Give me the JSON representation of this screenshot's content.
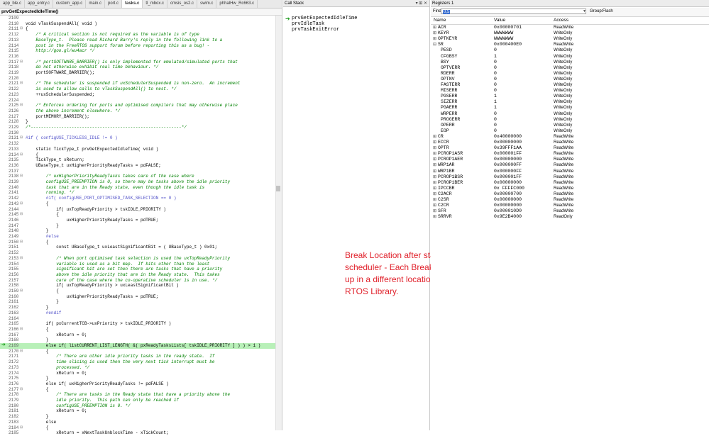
{
  "editor": {
    "tabs": [
      "app_ble.c",
      "app_entry.c",
      "custom_app.c",
      "main.c",
      "port.c",
      "tasks.c",
      "tl_mbox.c",
      "cmsis_os2.c",
      "swim.c",
      "phhalHw_Rc663.c"
    ],
    "active_tab": "tasks.c",
    "function_bar": "prvGetExpectedIdleTime()",
    "lines": [
      {
        "n": "2109",
        "t": ""
      },
      {
        "n": "2110",
        "t": "void vTaskSuspendAll( void )"
      },
      {
        "n": "2111",
        "t": "{",
        "f": "⊟"
      },
      {
        "n": "2112",
        "t": "    /* A critical section is not required as the variable is of type",
        "c": 1
      },
      {
        "n": "2113",
        "t": "    BaseType_t.  Please read Richard Barry's reply in the following link to a",
        "c": 1
      },
      {
        "n": "2114",
        "t": "    post in the FreeRTOS support forum before reporting this as a bug! -",
        "c": 1
      },
      {
        "n": "2115",
        "t": "    http://goo.gl/wu4acr */",
        "c": 1
      },
      {
        "n": "2116",
        "t": ""
      },
      {
        "n": "2117",
        "t": "    /* portSOFTWARE_BARRIER() is only implemented for emulated/simulated ports that",
        "c": 1,
        "f": "⊟"
      },
      {
        "n": "2118",
        "t": "    do not otherwise exhibit real time behaviour. */",
        "c": 1
      },
      {
        "n": "2119",
        "t": "    portSOFTWARE_BARRIER();"
      },
      {
        "n": "2120",
        "t": ""
      },
      {
        "n": "2121",
        "t": "    /* The scheduler is suspended if uxSchedulerSuspended is non-zero.  An increment",
        "c": 1,
        "f": "⊟"
      },
      {
        "n": "2122",
        "t": "    is used to allow calls to vTaskSuspendAll() to nest. */",
        "c": 1
      },
      {
        "n": "2123",
        "t": "    ++uxSchedulerSuspended;"
      },
      {
        "n": "2124",
        "t": ""
      },
      {
        "n": "2125",
        "t": "    /* Enforces ordering for ports and optimised compilers that may otherwise place",
        "c": 1,
        "f": "⊟"
      },
      {
        "n": "2126",
        "t": "    the above increment elsewhere. */",
        "c": 1
      },
      {
        "n": "2127",
        "t": "    portMEMORY_BARRIER();"
      },
      {
        "n": "2128",
        "t": "}"
      },
      {
        "n": "2129",
        "t": "/*-----------------------------------------------------------*/",
        "c": 1
      },
      {
        "n": "2130",
        "t": ""
      },
      {
        "n": "2131",
        "t": "#if ( configUSE_TICKLESS_IDLE != 0 )",
        "p": 1,
        "f": "⊟"
      },
      {
        "n": "2132",
        "t": ""
      },
      {
        "n": "2133",
        "t": "    static TickType_t prvGetExpectedIdleTime( void )"
      },
      {
        "n": "2134",
        "t": "    {",
        "f": "⊟"
      },
      {
        "n": "2135",
        "t": "    TickType_t xReturn;"
      },
      {
        "n": "2136",
        "t": "    UBaseType_t uxHigherPriorityReadyTasks = pdFALSE;"
      },
      {
        "n": "2137",
        "t": ""
      },
      {
        "n": "2138",
        "t": "        /* uxHigherPriorityReadyTasks takes care of the case where",
        "c": 1,
        "f": "⊟"
      },
      {
        "n": "2139",
        "t": "        configUSE_PREEMPTION is 0, so there may be tasks above the idle priority",
        "c": 1
      },
      {
        "n": "2140",
        "t": "        task that are in the Ready state, even though the idle task is",
        "c": 1
      },
      {
        "n": "2141",
        "t": "        running. */",
        "c": 1
      },
      {
        "n": "2142",
        "t": "        #if( configUSE_PORT_OPTIMISED_TASK_SELECTION == 0 )",
        "p": 1
      },
      {
        "n": "2143",
        "t": "        {",
        "f": "⊟"
      },
      {
        "n": "2144",
        "t": "            if( uxTopReadyPriority > tskIDLE_PRIORITY )"
      },
      {
        "n": "2145",
        "t": "            {",
        "f": "⊟"
      },
      {
        "n": "2146",
        "t": "                uxHigherPriorityReadyTasks = pdTRUE;"
      },
      {
        "n": "2147",
        "t": "            }"
      },
      {
        "n": "2148",
        "t": "        }"
      },
      {
        "n": "2149",
        "t": "        #else",
        "p": 1
      },
      {
        "n": "2150",
        "t": "        {",
        "f": "⊟"
      },
      {
        "n": "2151",
        "t": "            const UBaseType_t uxLeastSignificantBit = ( UBaseType_t ) 0x01;"
      },
      {
        "n": "2152",
        "t": ""
      },
      {
        "n": "2153",
        "t": "            /* When port optimised task selection is used the uxTopReadyPriority",
        "c": 1,
        "f": "⊟"
      },
      {
        "n": "2154",
        "t": "            variable is used as a bit map.  If bits other than the least",
        "c": 1
      },
      {
        "n": "2155",
        "t": "            significant bit are set then there are tasks that have a priority",
        "c": 1
      },
      {
        "n": "2156",
        "t": "            above the idle priority that are in the Ready state.  This takes",
        "c": 1
      },
      {
        "n": "2157",
        "t": "            care of the case where the co-operative scheduler is in use. */",
        "c": 1
      },
      {
        "n": "2158",
        "t": "            if( uxTopReadyPriority > uxLeastSignificantBit )"
      },
      {
        "n": "2159",
        "t": "            {",
        "f": "⊟"
      },
      {
        "n": "2160",
        "t": "                uxHigherPriorityReadyTasks = pdTRUE;"
      },
      {
        "n": "2161",
        "t": "            }"
      },
      {
        "n": "2162",
        "t": "        }"
      },
      {
        "n": "2163",
        "t": "        #endif",
        "p": 1
      },
      {
        "n": "2164",
        "t": ""
      },
      {
        "n": "2165",
        "t": "        if( pxCurrentTCB->uxPriority > tskIDLE_PRIORITY )"
      },
      {
        "n": "2166",
        "t": "        {",
        "f": "⊟"
      },
      {
        "n": "2167",
        "t": "            xReturn = 0;"
      },
      {
        "n": "2168",
        "t": "        }"
      },
      {
        "n": "2169",
        "t": "        else if( listCURRENT_LIST_LENGTH( &( pxReadyTasksLists[ tskIDLE_PRIORITY ] ) ) > 1 )",
        "h": 1
      },
      {
        "n": "2170",
        "t": "        {",
        "f": "⊟"
      },
      {
        "n": "2171",
        "t": "            /* There are other idle priority tasks in the ready state.  If",
        "c": 1
      },
      {
        "n": "2172",
        "t": "            time slicing is used then the very next tick interrupt must be",
        "c": 1
      },
      {
        "n": "2173",
        "t": "            processed. */",
        "c": 1
      },
      {
        "n": "2174",
        "t": "            xReturn = 0;"
      },
      {
        "n": "2175",
        "t": "        }"
      },
      {
        "n": "2176",
        "t": "        else if( uxHigherPriorityReadyTasks != pdFALSE )"
      },
      {
        "n": "2177",
        "t": "        {",
        "f": "⊟"
      },
      {
        "n": "2178",
        "t": "            /* There are tasks in the Ready state that have a priority above the",
        "c": 1
      },
      {
        "n": "2179",
        "t": "            idle priority.  This path can only be reached if",
        "c": 1
      },
      {
        "n": "2180",
        "t": "            configUSE_PREEMPTION is 0. */",
        "c": 1
      },
      {
        "n": "2181",
        "t": "            xReturn = 0;"
      },
      {
        "n": "2182",
        "t": "        }"
      },
      {
        "n": "2183",
        "t": "        else"
      },
      {
        "n": "2184",
        "t": "        {",
        "f": "⊟"
      },
      {
        "n": "2185",
        "t": "            xReturn = xNextTaskUnblockTime - xTickCount;"
      }
    ]
  },
  "call_stack": {
    "title": "Call Stack",
    "controls": "▾ ⊞ ✕",
    "frames": [
      "prvGetExpectedIdleTime",
      "prvIdleTask",
      "prvTaskExitError"
    ],
    "note": "Break Location after starting scheduler - Each Break ends up in a different location of RTOS Library."
  },
  "registers": {
    "title": "Registers 1",
    "find_label": "Find:",
    "find_value": "0,5",
    "group_label": "Group:",
    "group_value": "Flash",
    "columns": {
      "name": "Name",
      "value": "Value",
      "access": "Access"
    },
    "rows": [
      {
        "name": "ACR",
        "value": "0x00000701",
        "access": "ReadWrite",
        "ex": "⊞"
      },
      {
        "name": "KEYR",
        "value": "WWWWWWW",
        "access": "WriteOnly",
        "ex": "⊞"
      },
      {
        "name": "OPTKEYR",
        "value": "WWWWWWW",
        "access": "WriteOnly",
        "ex": "⊞"
      },
      {
        "name": "SR",
        "value": "0x000400E0",
        "access": "ReadWrite",
        "ex": "⊟"
      },
      {
        "name": "PESD",
        "value": "0",
        "access": "WriteOnly",
        "child": true
      },
      {
        "name": "CFGBSY",
        "value": "1",
        "access": "WriteOnly",
        "child": true
      },
      {
        "name": "BSY",
        "value": "0",
        "access": "WriteOnly",
        "child": true
      },
      {
        "name": "OPTVERR",
        "value": "0",
        "access": "WriteOnly",
        "child": true
      },
      {
        "name": "RDERR",
        "value": "0",
        "access": "WriteOnly",
        "child": true
      },
      {
        "name": "OPTNV",
        "value": "0",
        "access": "WriteOnly",
        "child": true
      },
      {
        "name": "FASTERR",
        "value": "0",
        "access": "WriteOnly",
        "child": true
      },
      {
        "name": "MISERR",
        "value": "0",
        "access": "WriteOnly",
        "child": true
      },
      {
        "name": "PGSERR",
        "value": "1",
        "access": "WriteOnly",
        "child": true
      },
      {
        "name": "SIZERR",
        "value": "1",
        "access": "WriteOnly",
        "child": true
      },
      {
        "name": "PGAERR",
        "value": "1",
        "access": "WriteOnly",
        "child": true
      },
      {
        "name": "WRPERR",
        "value": "0",
        "access": "WriteOnly",
        "child": true
      },
      {
        "name": "PROGERR",
        "value": "0",
        "access": "WriteOnly",
        "child": true
      },
      {
        "name": "OPERR",
        "value": "0",
        "access": "WriteOnly",
        "child": true
      },
      {
        "name": "EOP",
        "value": "0",
        "access": "WriteOnly",
        "child": true
      },
      {
        "name": "CR",
        "value": "0x40000000",
        "access": "ReadWrite",
        "ex": "⊞"
      },
      {
        "name": "ECCR",
        "value": "0x00000000",
        "access": "ReadWrite",
        "ex": "⊞"
      },
      {
        "name": "OPTR",
        "value": "0x39FFF1AA",
        "access": "ReadWrite",
        "ex": "⊞"
      },
      {
        "name": "PCROP1ASR",
        "value": "0x000001FF",
        "access": "ReadWrite",
        "ex": "⊞"
      },
      {
        "name": "PCROP1AER",
        "value": "0x00000000",
        "access": "ReadWrite",
        "ex": "⊞"
      },
      {
        "name": "WRP1AR",
        "value": "0x000000FF",
        "access": "ReadWrite",
        "ex": "⊞"
      },
      {
        "name": "WRP1BR",
        "value": "0x000000FF",
        "access": "ReadWrite",
        "ex": "⊞"
      },
      {
        "name": "PCROP1BSR",
        "value": "0x000001FF",
        "access": "ReadWrite",
        "ex": "⊞"
      },
      {
        "name": "PCROP1BER",
        "value": "0x00000000",
        "access": "ReadWrite",
        "ex": "⊞"
      },
      {
        "name": "IPCCBR",
        "value": "0x FFFFC000",
        "access": "ReadWrite",
        "ex": "⊞"
      },
      {
        "name": "C2ACR",
        "value": "0x00000700",
        "access": "ReadWrite",
        "ex": "⊞"
      },
      {
        "name": "C2SR",
        "value": "0x00000000",
        "access": "ReadWrite",
        "ex": "⊞"
      },
      {
        "name": "C2CR",
        "value": "0x00000000",
        "access": "ReadWrite",
        "ex": "⊞"
      },
      {
        "name": "SFR",
        "value": "0x000010D0",
        "access": "ReadWrite",
        "ex": "⊞"
      },
      {
        "name": "SRRVR",
        "value": "0x9E2B4000",
        "access": "ReadOnly",
        "ex": "⊞"
      }
    ]
  }
}
